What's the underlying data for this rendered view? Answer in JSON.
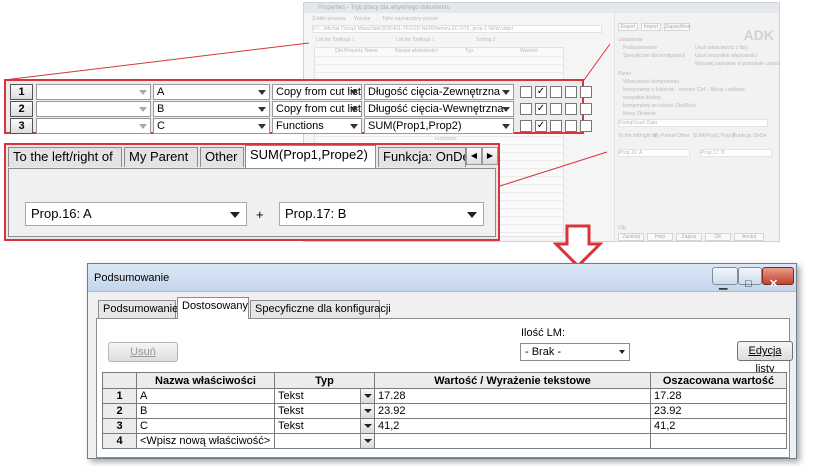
{
  "bg_window": {
    "title": "Properties - Tryb pracy dla aktywnego dokumentu",
    "top_label_1": "Źródło procesu",
    "top_label_2": "Wzyste",
    "top_label_3": "Tylko zaznaczony proces",
    "path": "D:\\...\\Michał (Temp) Mata\\Sbik\\2DS\\401-TFG\\2D-NEW\\Items\\LSC-DTF_prop-1 NEW.sldprt",
    "list_a": "List for Settings 1",
    "list_b": "List for Settings 1",
    "list_c": "Setting 2",
    "col_old": "Old Property Name",
    "col_name": "Nazwa właściwości",
    "col_type": "Typ",
    "col_value": "Wartość",
    "btn_export": "Export",
    "btn_import": "Import",
    "btn_options": "Zapisz/Ikon",
    "logo": "ADK",
    "r_ustawienia": "Ustawienia",
    "r_1": "Podsumowanie",
    "r_2": "Specyficzne dla konfiguracji",
    "r_3": "Usuń właściwości z listy",
    "r_4": "Usuń wszystkie właściwości",
    "r_5": "Wywołaj zapisanie w pozostałe części",
    "r_panel": "Panel",
    "r_6": "Właściwości komponentu",
    "r_7": "komponenty z folderów - drzewo 'Ctrl' - klikraj i zaklarta",
    "r_8": "wszystkie foldery",
    "r_9": "komponenty ze ścieżki (ToolBox)",
    "r_10": "Nowy Złożenie",
    "r_data": "Dodaj/Usuń Data",
    "tab_a": "To the left/right of",
    "tab_b": "My Parent",
    "tab_c": "Other",
    "tab_d": "SUM(Prop1,Prop2)",
    "tab_e": "Funkcja: OnDe",
    "prop_a": "Prop.16: A",
    "prop_b": "Prop.17: B",
    "fn": "Functions",
    "btn_close": "Zamknij",
    "btn_help": "Help",
    "btn_apply": "Zapisz",
    "btn_ok": "OK",
    "btn_cancel": "Anuluj",
    "cfg": "Cfg"
  },
  "zoom_rows": [
    {
      "num": "1",
      "prop": "A",
      "source": "Copy from cut lists",
      "value": "Długość cięcia-Zewnętrzna",
      "checks": [
        false,
        true,
        false,
        false,
        false
      ]
    },
    {
      "num": "2",
      "prop": "B",
      "source": "Copy from cut lists",
      "value": "Długość cięcia-Wewnętrzna",
      "checks": [
        false,
        true,
        false,
        false,
        false
      ]
    },
    {
      "num": "3",
      "prop": "C",
      "source": "Functions",
      "value": "SUM(Prop1,Prop2)",
      "checks": [
        false,
        true,
        false,
        false,
        false
      ]
    }
  ],
  "zoom_tabs": [
    {
      "label": "To the left/right of"
    },
    {
      "label": "My Parent"
    },
    {
      "label": "Other"
    },
    {
      "label": "SUM(Prop1,Prope2)"
    },
    {
      "label": "Funkcja: OnDe"
    }
  ],
  "zoom_formula": {
    "left": "Prop.16: A",
    "op": "+",
    "right": "Prop.17: B"
  },
  "check_mark": "✓",
  "dialog": {
    "title": "Podsumowanie",
    "win_min": "▁",
    "win_max": "□",
    "win_close": "✕",
    "tabs": [
      "Podsumowanie",
      "Dostosowany",
      "Specyficzne dla konfiguracji"
    ],
    "delete_button": "Usuń",
    "lm_label": "Ilość LM:",
    "lm_value": "- Brak -",
    "edit_list_button": "Edycja listy",
    "columns": [
      "Nazwa właściwości",
      "Typ",
      "Wartość / Wyrażenie tekstowe",
      "Oszacowana wartość"
    ],
    "rows": [
      {
        "num": "1",
        "name": "A",
        "type": "Tekst",
        "value": "17.28",
        "evaluated": "17.28"
      },
      {
        "num": "2",
        "name": "B",
        "type": "Tekst",
        "value": "23.92",
        "evaluated": "23.92"
      },
      {
        "num": "3",
        "name": "C",
        "type": "Tekst",
        "value": "41,2",
        "evaluated": "41,2"
      },
      {
        "num": "4",
        "name": "<Wpisz nową właściwość>",
        "type": "",
        "value": "",
        "evaluated": ""
      }
    ]
  },
  "colors": {
    "highlight": "#d9343c",
    "arrow_fill": "#ffffff",
    "arrow_stroke": "#d9343c"
  }
}
